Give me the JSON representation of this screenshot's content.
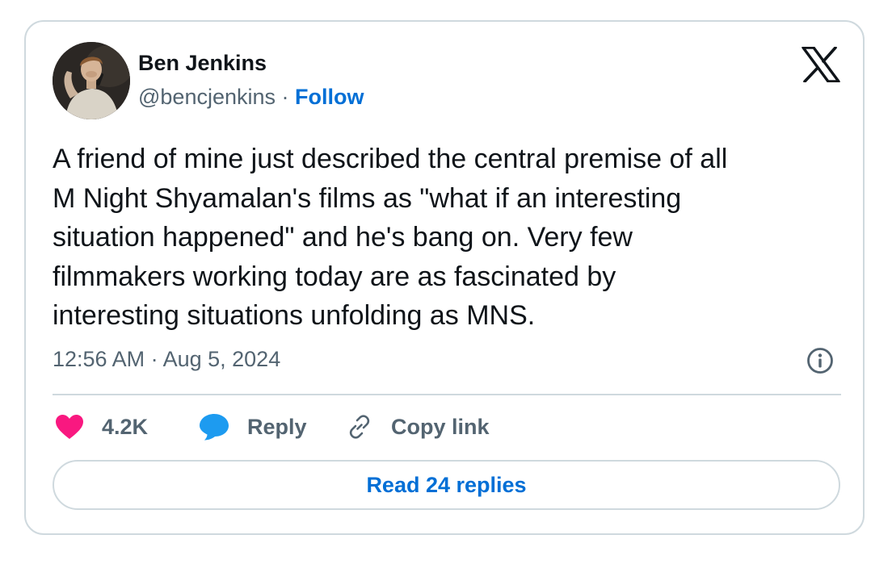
{
  "author": {
    "display_name": "Ben Jenkins",
    "handle": "@bencjenkins",
    "separator": " · ",
    "follow_label": "Follow"
  },
  "tweet": {
    "text": "A friend of mine just described the central premise of all\nM Night Shyamalan's films as \"what if an interesting\nsituation happened\" and he's bang on. Very few\nfilmmakers working today are as fascinated by\ninteresting situations unfolding as MNS.",
    "timestamp": "12:56 AM · Aug 5, 2024"
  },
  "actions": {
    "like_count": "4.2K",
    "reply_label": "Reply",
    "copy_link_label": "Copy link"
  },
  "read_replies_label": "Read 24 replies",
  "icons": {
    "brand": "x-logo-icon",
    "info": "info-icon",
    "like": "heart-icon",
    "reply": "speech-bubble-icon",
    "copy_link": "link-icon"
  },
  "colors": {
    "heart": "#f91880",
    "reply_bubble": "#1d9bf0",
    "link_blue": "#006fd6",
    "muted_text": "#536471",
    "border": "#cfd9de"
  }
}
